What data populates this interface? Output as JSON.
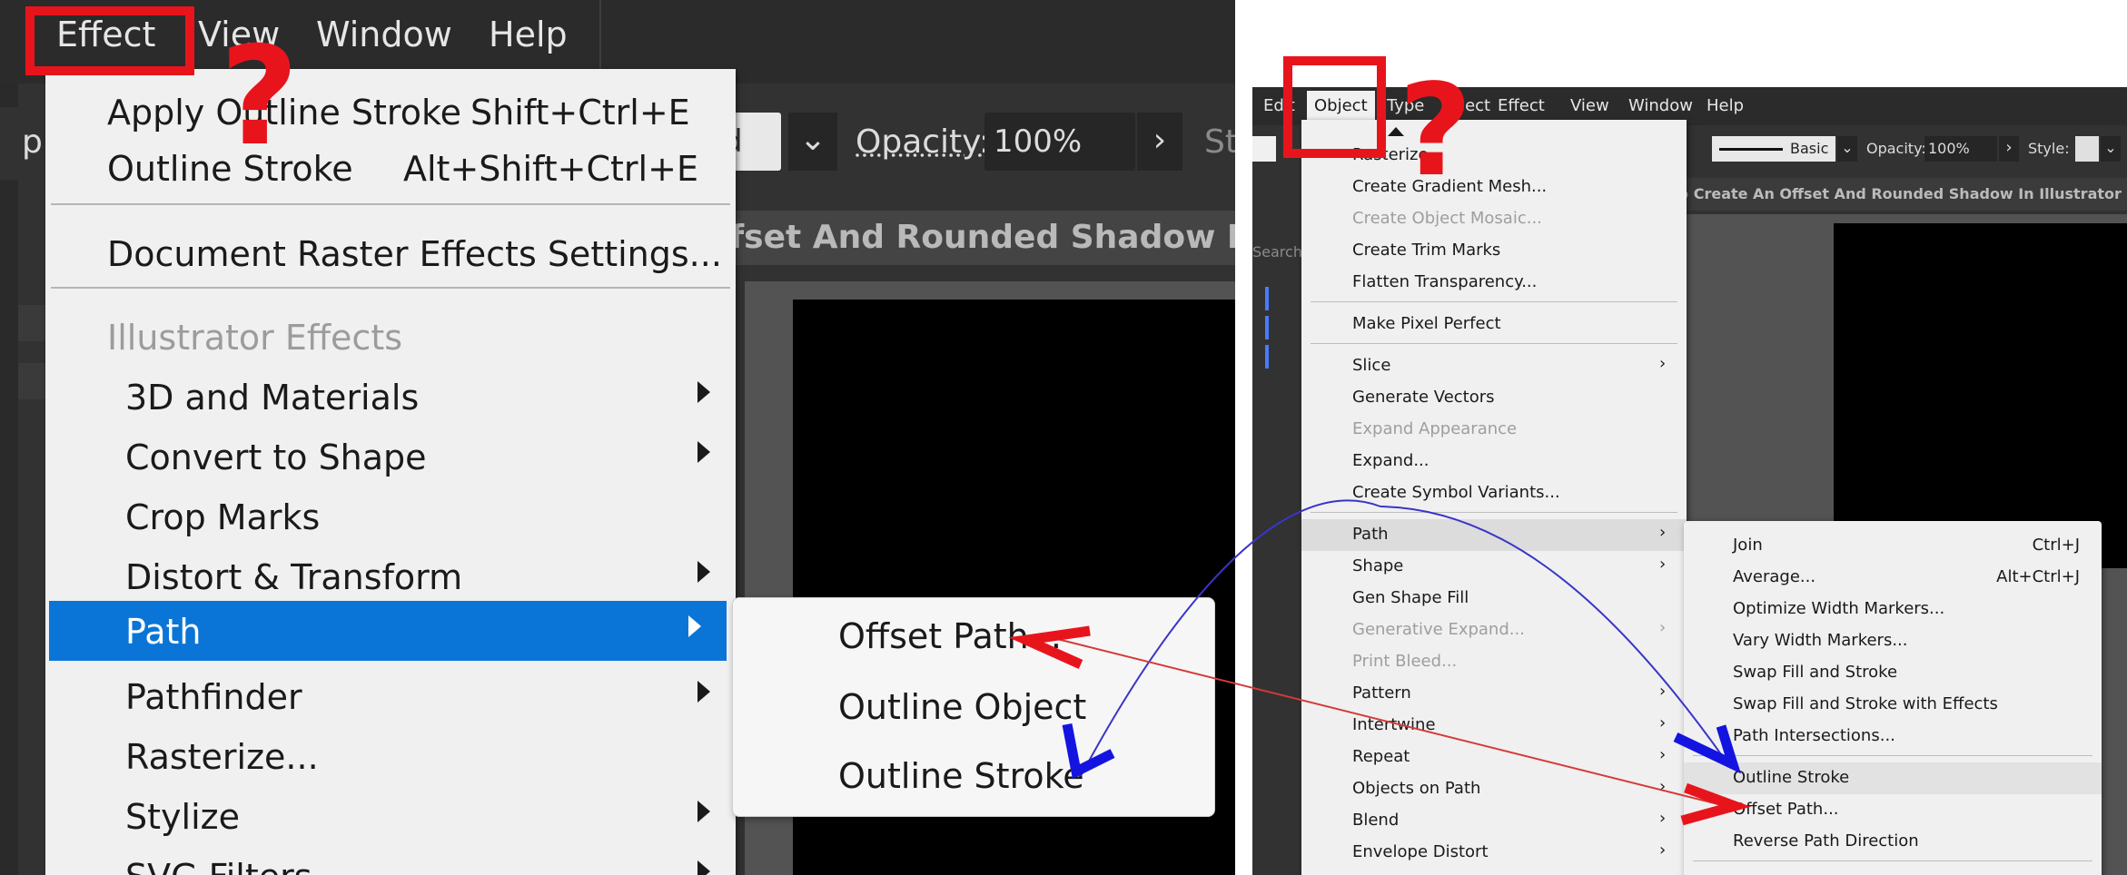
{
  "left": {
    "menubar": {
      "partial": "ᴉ",
      "effect": "Effect",
      "view": "View",
      "window": "Window",
      "help": "Help"
    },
    "controlbar": {
      "left_clip": "p",
      "field_clip": "d",
      "opacity_label": "Opacity:",
      "opacity_value": "100%",
      "right_clip": "St"
    },
    "document_tab": "ffset And Rounded Shadow In Ill",
    "effect_menu": {
      "apply_outline_stroke": {
        "label": "Apply Outline Stroke",
        "shortcut": "Shift+Ctrl+E"
      },
      "outline_stroke": {
        "label": "Outline Stroke",
        "shortcut": "Alt+Shift+Ctrl+E"
      },
      "document_raster": "Document Raster Effects Settings...",
      "illustrator_effects_header": "Illustrator Effects",
      "items": [
        "3D and Materials",
        "Convert to Shape",
        "Crop Marks",
        "Distort & Transform",
        "Path",
        "Pathfinder",
        "Rasterize...",
        "Stylize",
        "SVG Filters"
      ]
    },
    "path_submenu": [
      "Offset Path...",
      "Outline Object",
      "Outline Stroke"
    ]
  },
  "right": {
    "menubar": {
      "edit": "Edit",
      "object": "Object",
      "type": "Type",
      "select": "elect",
      "effect": "Effect",
      "view": "View",
      "window": "Window",
      "help": "Help"
    },
    "controlbar": {
      "stroke_style": "Basic",
      "opacity_label": "Opacity:",
      "opacity_value": "100%",
      "style_label": "Style:"
    },
    "document_tab": "w To Create An Offset And Rounded Shadow In Illustrator (With",
    "search_label": "Search",
    "object_menu": {
      "rasterize": "Rasterize...",
      "create_gradient_mesh": "Create Gradient Mesh...",
      "create_object_mosaic": "Create Object Mosaic...",
      "create_trim_marks": "Create Trim Marks",
      "flatten_transparency": "Flatten Transparency...",
      "make_pixel_perfect": "Make Pixel Perfect",
      "slice": "Slice",
      "generate_vectors": "Generate Vectors",
      "expand_appearance": "Expand Appearance",
      "expand": "Expand...",
      "create_symbol_variants": "Create Symbol Variants...",
      "path": "Path",
      "shape": "Shape",
      "gen_shape_fill": "Gen Shape Fill",
      "generative_expand": "Generative Expand...",
      "print_bleed": "Print Bleed...",
      "pattern": "Pattern",
      "intertwine": "Intertwine",
      "repeat": "Repeat",
      "objects_on_path": "Objects on Path",
      "blend": "Blend",
      "envelope_distort": "Envelope Distort"
    },
    "path_submenu": {
      "join": {
        "label": "Join",
        "shortcut": "Ctrl+J"
      },
      "average": {
        "label": "Average...",
        "shortcut": "Alt+Ctrl+J"
      },
      "optimize_width_markers": "Optimize Width Markers...",
      "vary_width_markers": "Vary Width Markers...",
      "swap_fill_stroke": "Swap Fill and Stroke",
      "swap_fill_stroke_effects": "Swap Fill and Stroke with Effects",
      "path_intersections": "Path Intersections...",
      "outline_stroke": "Outline Stroke",
      "offset_path": "Offset Path...",
      "reverse_path_direction": "Reverse Path Direction"
    }
  },
  "annotations": {
    "question_mark": "?"
  },
  "colors": {
    "annotation_red": "#e8141c",
    "annotation_blue": "#1414e0",
    "menu_highlight": "#0a75d6"
  }
}
